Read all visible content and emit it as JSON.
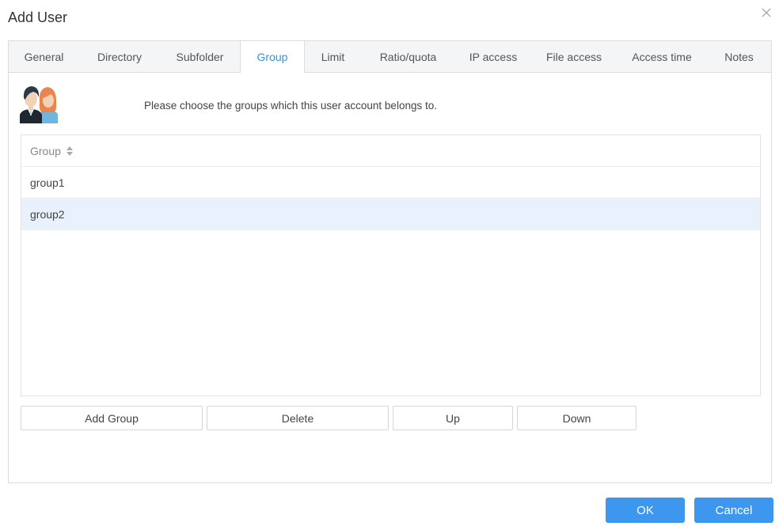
{
  "dialog": {
    "title": "Add User",
    "close_icon": "close-icon"
  },
  "tabs": [
    {
      "label": "General",
      "active": false
    },
    {
      "label": "Directory",
      "active": false
    },
    {
      "label": "Subfolder",
      "active": false
    },
    {
      "label": "Group",
      "active": true
    },
    {
      "label": "Limit",
      "active": false
    },
    {
      "label": "Ratio/quota",
      "active": false
    },
    {
      "label": "IP access",
      "active": false
    },
    {
      "label": "File access",
      "active": false
    },
    {
      "label": "Access time",
      "active": false
    },
    {
      "label": "Notes",
      "active": false
    }
  ],
  "group_tab": {
    "icon": "users-icon",
    "description": "Please choose the groups which this user account belongs to.",
    "table": {
      "header": "Group",
      "sort_icon": "sort-icon",
      "rows": [
        {
          "name": "group1",
          "selected": false
        },
        {
          "name": "group2",
          "selected": true
        }
      ]
    },
    "buttons": {
      "add": "Add Group",
      "delete": "Delete",
      "up": "Up",
      "down": "Down"
    }
  },
  "footer": {
    "ok": "OK",
    "cancel": "Cancel"
  },
  "colors": {
    "accent": "#3d97ee",
    "active_tab_text": "#3b8fdc",
    "selected_row": "#e8f1fc"
  }
}
